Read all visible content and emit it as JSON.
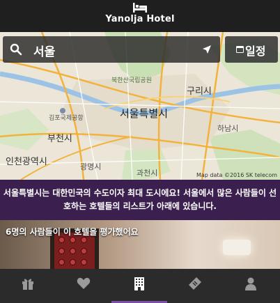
{
  "header": {
    "title": "Yanolja Hotel",
    "logo_icon": "bed-icon"
  },
  "search": {
    "query": "서울",
    "search_icon": "search-icon",
    "location_icon": "location-arrow-icon"
  },
  "date_button": {
    "label": "일정",
    "icon": "calendar-icon"
  },
  "map": {
    "labels": {
      "seoul": "서울특별시",
      "guri": "구리시",
      "hanam": "하남시",
      "bucheon": "부천시",
      "incheon": "인천광역시",
      "gwangmyeong": "광명시",
      "gwacheon": "과천시",
      "gimpo_airport": "김포국제공항",
      "bukhansan": "북한산국립공원"
    },
    "attribution": "Map data ©2016 SK telecom"
  },
  "banner": {
    "text": "서울특별시는 대한민국의 수도이자 최대 도시에요! 서울에서 많은 사람들이 선호하는 호텔들의 리스트가 아래에 있습니다."
  },
  "hotel_card": {
    "rating_text": "6명의 사람들이 이 호텔을 평가했어요"
  },
  "nav": {
    "items": [
      {
        "name": "gift-icon"
      },
      {
        "name": "heart-icon"
      },
      {
        "name": "building-icon"
      },
      {
        "name": "ticket-icon"
      },
      {
        "name": "user-icon"
      }
    ],
    "active_index": 2
  },
  "colors": {
    "header_bg": "#1f1f1f",
    "banner_bg": "#3b1f4f",
    "active_underline": "#7b4fa3",
    "nav_bg": "#2b2b2b"
  }
}
